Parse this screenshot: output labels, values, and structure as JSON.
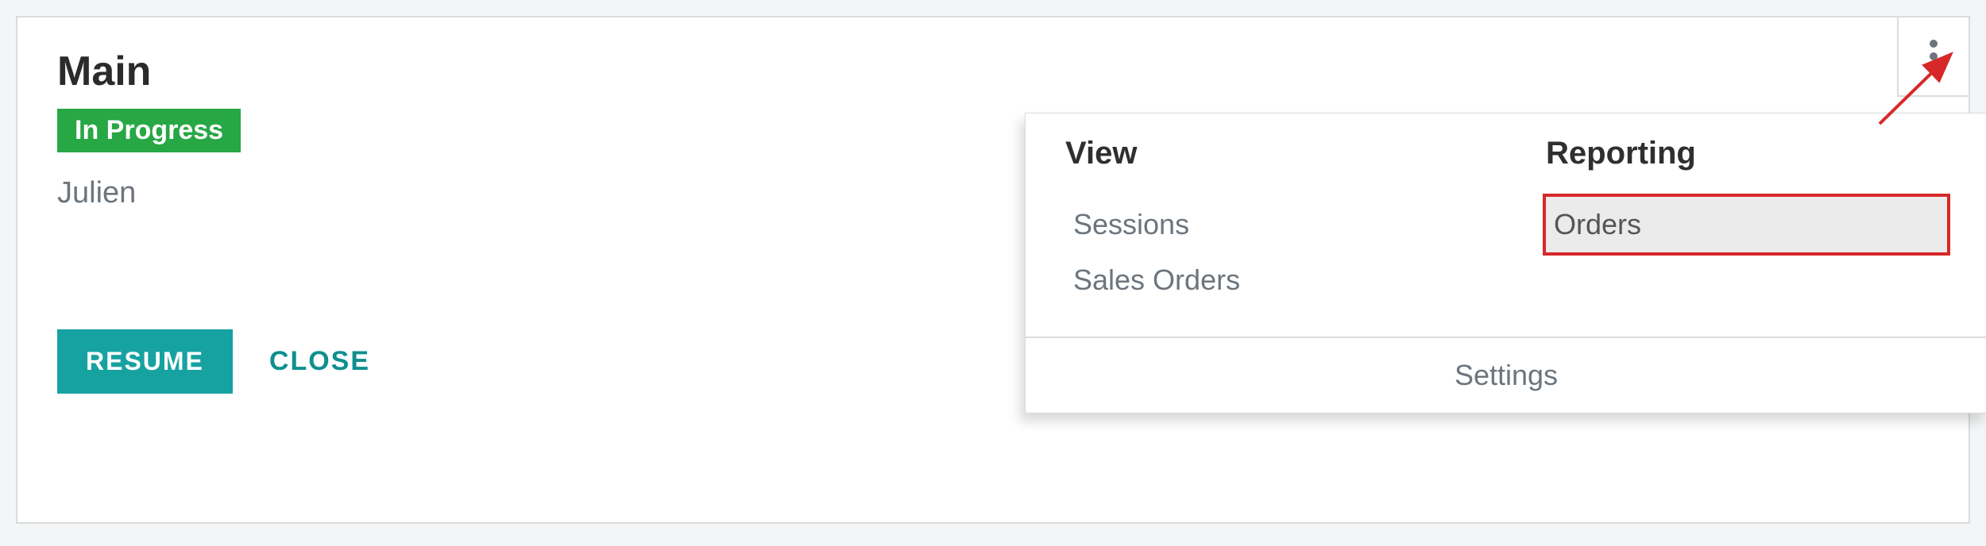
{
  "card": {
    "title": "Main",
    "status": "In Progress",
    "user": "Julien",
    "resume_label": "RESUME",
    "close_label": "CLOSE"
  },
  "dropdown": {
    "view_header": "View",
    "view_items": [
      "Sessions",
      "Sales Orders"
    ],
    "reporting_header": "Reporting",
    "reporting_items": [
      "Orders"
    ],
    "footer": "Settings"
  },
  "colors": {
    "teal": "#17a2a2",
    "green": "#28a745",
    "highlight": "#d62828"
  }
}
